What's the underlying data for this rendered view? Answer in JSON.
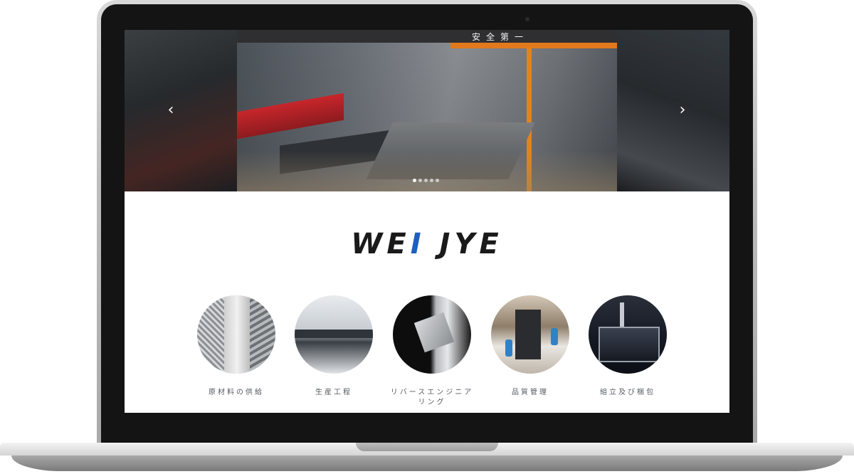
{
  "banner": {
    "slogan": "安全第一",
    "prev_arrow": "‹",
    "next_arrow": "›",
    "dot_count": 5,
    "active_dot": 0
  },
  "logo": {
    "part1": "WE",
    "bar": "I",
    "part2": " JYE"
  },
  "services": [
    {
      "label": "原材料の供給",
      "icon": "raw-material-image"
    },
    {
      "label": "生産工程",
      "icon": "production-process-image"
    },
    {
      "label": "リバースエンジニアリング",
      "icon": "reverse-engineering-image"
    },
    {
      "label": "品質管理",
      "icon": "quality-control-image"
    },
    {
      "label": "組立及び梱包",
      "icon": "assembly-packaging-image"
    }
  ],
  "colors": {
    "logo_accent": "#1e5fbf",
    "logo_text": "#1a1a1a",
    "label_text": "#555a60"
  }
}
